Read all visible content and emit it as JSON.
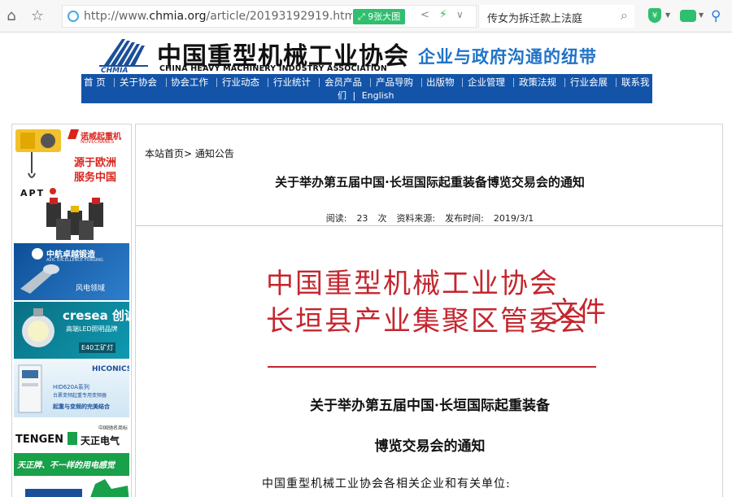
{
  "browser": {
    "url_prefix": "http://www.",
    "url_host": "chmia.org",
    "url_path": "/article/20193192919.htm",
    "image_button": "9张大图",
    "search_query": "传女为拆迁款上法庭",
    "colors": {
      "accent_green": "#2fbf6e",
      "find_blue": "#2a7be4"
    }
  },
  "site": {
    "logo_text": "中国重型机械工业协会",
    "logo_en": "CHINA HEAVY MACHINERY INDUSTRY ASSOCIATION",
    "slogan": "企业与政府沟通的纽带",
    "nav": [
      "首 页",
      "关于协会",
      "协会工作",
      "行业动态",
      "行业统计",
      "会员产品",
      "产品导购",
      "出版物",
      "企业管理",
      "政策法规",
      "行业会展",
      "联系我"
    ],
    "nav_wrap": "们",
    "nav_english": "English",
    "colors": {
      "nav_bg": "#1354a8",
      "slogan": "#1f73c8",
      "red": "#c4262e"
    }
  },
  "sidebar": {
    "ads": [
      {
        "brand": "诺威起重机",
        "brand_en": "NOVECRANES",
        "line1": "源于欧洲",
        "line2": "服务中国"
      },
      {
        "brand": "APT"
      },
      {
        "brand": "中航卓越锻造",
        "brand_en": "AVIC EXCELLENCE FORGING",
        "caption": "风电领域"
      },
      {
        "brand": "cresea 创诚",
        "line1": "高端LED照明品牌",
        "caption": "E40工矿灯"
      },
      {
        "brand": "HICONICS",
        "line1": "HID620A系列",
        "line2": "台裹变频起重专用变频器",
        "line3": "起重与变频的完美结合"
      },
      {
        "brand": "TENGEN",
        "brand_cn": "天正电气",
        "tag": "中国驰名商标"
      },
      {
        "slogan": "天正牌、不一样的用电感觉"
      },
      {
        "brand": ""
      }
    ]
  },
  "article": {
    "breadcrumb_home": "本站首页",
    "breadcrumb_sep": ">",
    "breadcrumb_section": "通知公告",
    "title": "关于举办第五届中国·长垣国际起重装备博览交易会的通知",
    "meta": {
      "reads_label": "阅读:",
      "reads_value": "23",
      "reads_unit": "次",
      "source_label": "资料来源:",
      "date_label": "发布时间:",
      "date_value": "2019/3/1"
    },
    "doc": {
      "issuer1": "中国重型机械工业协会",
      "issuer2": "长垣县产业集聚区管委会",
      "doc_word": "文件",
      "title_line1": "关于举办第五届中国·长垣国际起重装备",
      "title_line2": "博览交易会的通知",
      "salutation": "中国重型机械工业协会各相关企业和有关单位:"
    }
  }
}
